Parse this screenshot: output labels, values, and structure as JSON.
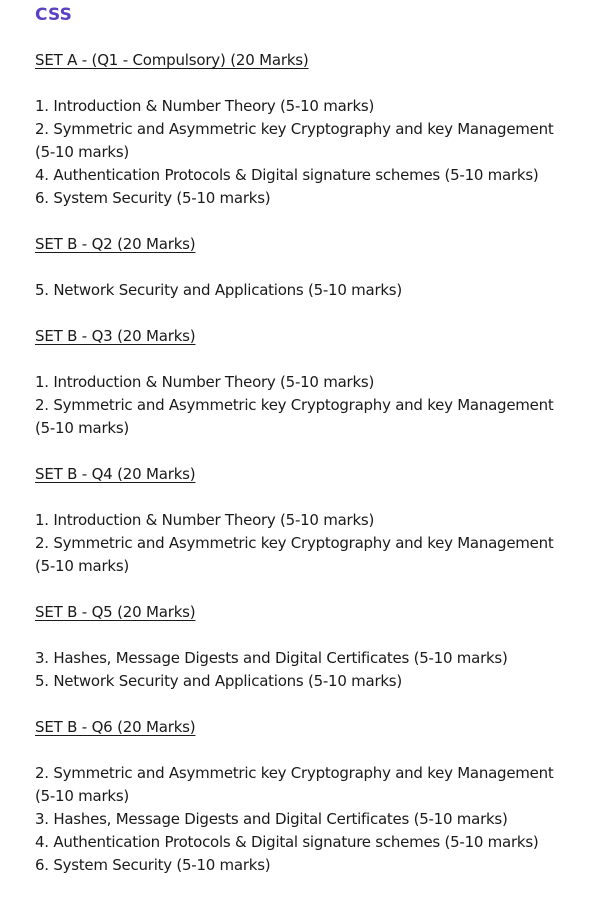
{
  "doc": {
    "title": "CSS",
    "sections": [
      {
        "heading": "SET A - (Q1 - Compulsory) (20 Marks)",
        "items": [
          "1. Introduction & Number Theory (5-10 marks)",
          "2. Symmetric and Asymmetric key Cryptography and key Management (5-10 marks)",
          "4. Authentication Protocols & Digital signature schemes (5-10 marks)",
          "6. System Security (5-10 marks)"
        ]
      },
      {
        "heading": "SET B - Q2 (20 Marks)",
        "items": [
          "5. Network Security and Applications (5-10 marks)"
        ]
      },
      {
        "heading": "SET B - Q3 (20 Marks)",
        "items": [
          "1. Introduction & Number Theory (5-10 marks)",
          "2. Symmetric and Asymmetric key Cryptography and key Management (5-10 marks)"
        ]
      },
      {
        "heading": "SET B - Q4 (20 Marks)",
        "items": [
          "1. Introduction & Number Theory (5-10 marks)",
          "2. Symmetric and Asymmetric key Cryptography and key Management (5-10 marks)"
        ]
      },
      {
        "heading": "SET B - Q5 (20 Marks)",
        "items": [
          "3. Hashes, Message Digests and Digital Certificates (5-10 marks)",
          "5. Network Security and Applications (5-10 marks)"
        ]
      },
      {
        "heading": "SET B - Q6 (20 Marks)",
        "items": [
          "2. Symmetric and Asymmetric key Cryptography and key Management (5-10 marks)",
          "3. Hashes, Message Digests and Digital Certificates (5-10 marks)",
          "4. Authentication Protocols & Digital signature schemes (5-10 marks)",
          "6. System Security (5-10 marks)"
        ]
      }
    ]
  }
}
